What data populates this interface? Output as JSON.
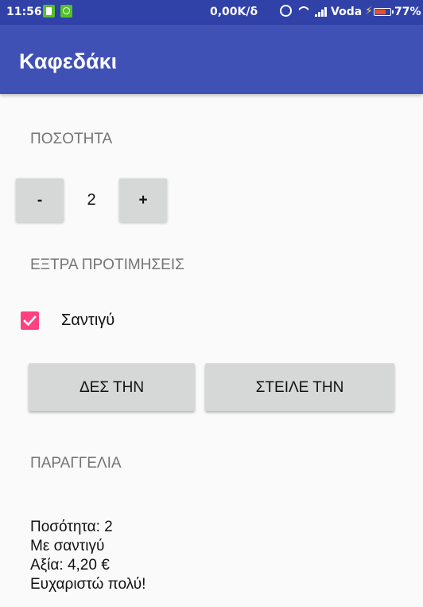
{
  "status_bar": {
    "time": "11:56",
    "net_speed": "0,00K/δ",
    "carrier": "Voda",
    "battery": "77%",
    "battery_level": 0.77,
    "icons": [
      "battery-notification-icon",
      "android-notification-icon",
      "alarm-icon",
      "wifi-icon",
      "signal-icon",
      "charging-icon",
      "battery-icon"
    ]
  },
  "app_bar": {
    "title": "Καφεδάκι",
    "color": "#3f51b5"
  },
  "quantity": {
    "label": "ΠΟΣΟΤΗΤΑ",
    "decrement_label": "-",
    "value": "2",
    "increment_label": "+"
  },
  "extras": {
    "label": "ΕΞΤΡΑ ΠΡΟΤΙΜΗΣΕΙΣ",
    "whipped_cream_label": "Σαντιγύ",
    "whipped_cream_checked": true,
    "accent_color": "#ff4081"
  },
  "actions": {
    "view_label": "ΔΕΣ ΤΗΝ",
    "send_label": "ΣΤΕΙΛΕ ΤΗΝ"
  },
  "order": {
    "label": "ΠΑΡΑΓΓΕΛΙΑ",
    "lines": [
      "Ποσότητα: 2",
      "Με σαντιγύ",
      "Αξία: 4,20 €",
      "Ευχαριστώ πολύ!"
    ]
  }
}
